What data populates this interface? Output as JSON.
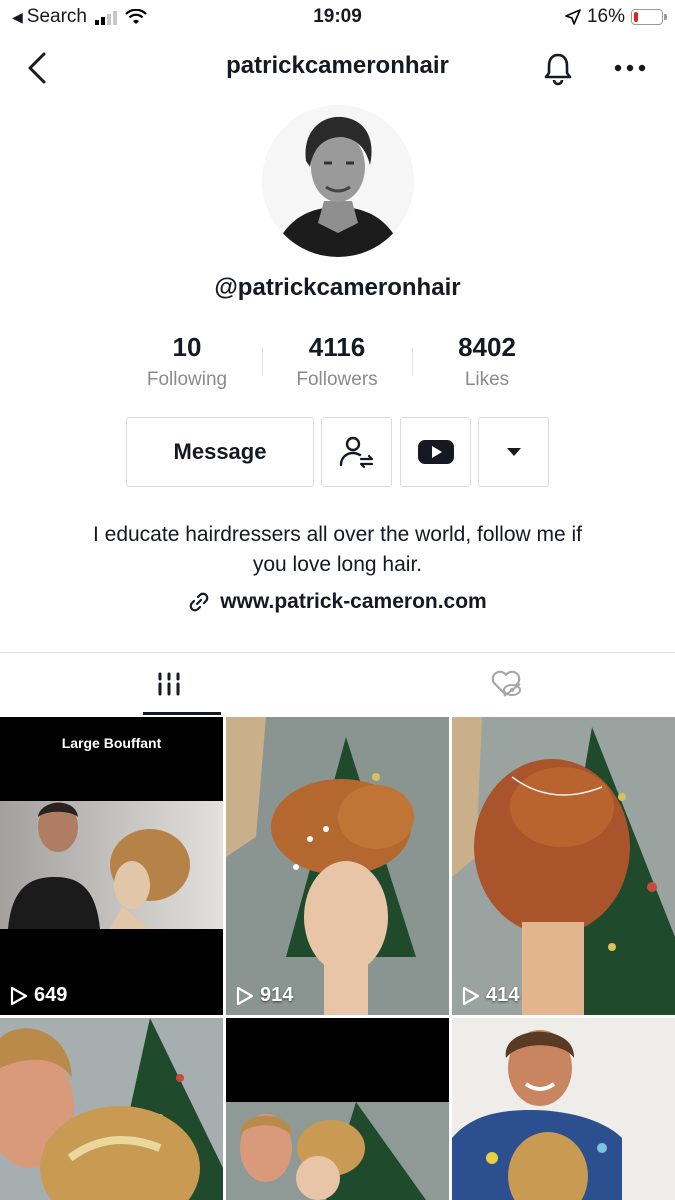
{
  "status_bar": {
    "back_app": "Search",
    "time": "19:09",
    "battery_percent": "16%",
    "battery_level": 0.16
  },
  "header": {
    "title": "patrickcameronhair"
  },
  "profile": {
    "handle": "@patrickcameronhair",
    "stats": [
      {
        "value": "10",
        "label": "Following"
      },
      {
        "value": "4116",
        "label": "Followers"
      },
      {
        "value": "8402",
        "label": "Likes"
      }
    ],
    "message_label": "Message",
    "bio_line1": "I educate hairdressers all over the world, follow me if",
    "bio_line2": "you love long hair.",
    "website": "www.patrick-cameron.com"
  },
  "tabs": [
    {
      "icon": "grid-icon",
      "active": true
    },
    {
      "icon": "liked-hidden-icon",
      "active": false
    }
  ],
  "videos": [
    {
      "views": "649",
      "caption": "Large Bouffant"
    },
    {
      "views": "914"
    },
    {
      "views": "414"
    },
    {
      "views": ""
    },
    {
      "views": ""
    },
    {
      "views": ""
    }
  ],
  "colors": {
    "text": "#161823",
    "muted": "#8a8b91",
    "border": "#dcdcdd",
    "battery_low": "#e0241e"
  }
}
